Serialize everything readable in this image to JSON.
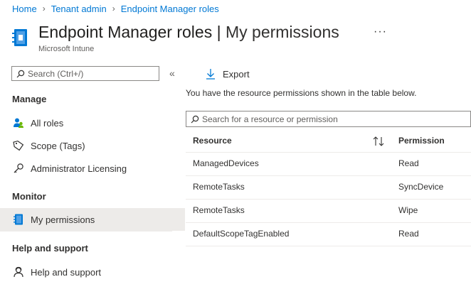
{
  "breadcrumb": [
    {
      "label": "Home"
    },
    {
      "label": "Tenant admin"
    },
    {
      "label": "Endpoint Manager roles"
    }
  ],
  "header": {
    "title_main": "Endpoint Manager roles",
    "title_sep": "|",
    "title_page": "My permissions",
    "subtitle": "Microsoft Intune",
    "more": "···"
  },
  "sidebar": {
    "search_placeholder": "Search (Ctrl+/)",
    "collapse": "«",
    "sections": [
      {
        "label": "Manage"
      },
      {
        "label": "Monitor"
      },
      {
        "label": "Help and support"
      }
    ],
    "items": [
      {
        "label": "All roles",
        "icon": "users-icon"
      },
      {
        "label": "Scope (Tags)",
        "icon": "tag-icon"
      },
      {
        "label": "Administrator Licensing",
        "icon": "key-icon"
      },
      {
        "label": "My permissions",
        "icon": "permissions-icon",
        "selected": true
      },
      {
        "label": "Help and support",
        "icon": "person-support-icon"
      }
    ]
  },
  "toolbar": {
    "export_label": "Export"
  },
  "main": {
    "description": "You have the resource permissions shown in the table below.",
    "filter_placeholder": "Search for a resource or permission",
    "table": {
      "headers": {
        "resource": "Resource",
        "permission": "Permission"
      },
      "rows": [
        {
          "resource": "ManagedDevices",
          "permission": "Read"
        },
        {
          "resource": "RemoteTasks",
          "permission": "SyncDevice"
        },
        {
          "resource": "RemoteTasks",
          "permission": "Wipe"
        },
        {
          "resource": "DefaultScopeTagEnabled",
          "permission": "Read"
        }
      ]
    }
  },
  "colors": {
    "accent": "#0078d4",
    "selected_bg": "#edebe9",
    "text": "#323130"
  }
}
